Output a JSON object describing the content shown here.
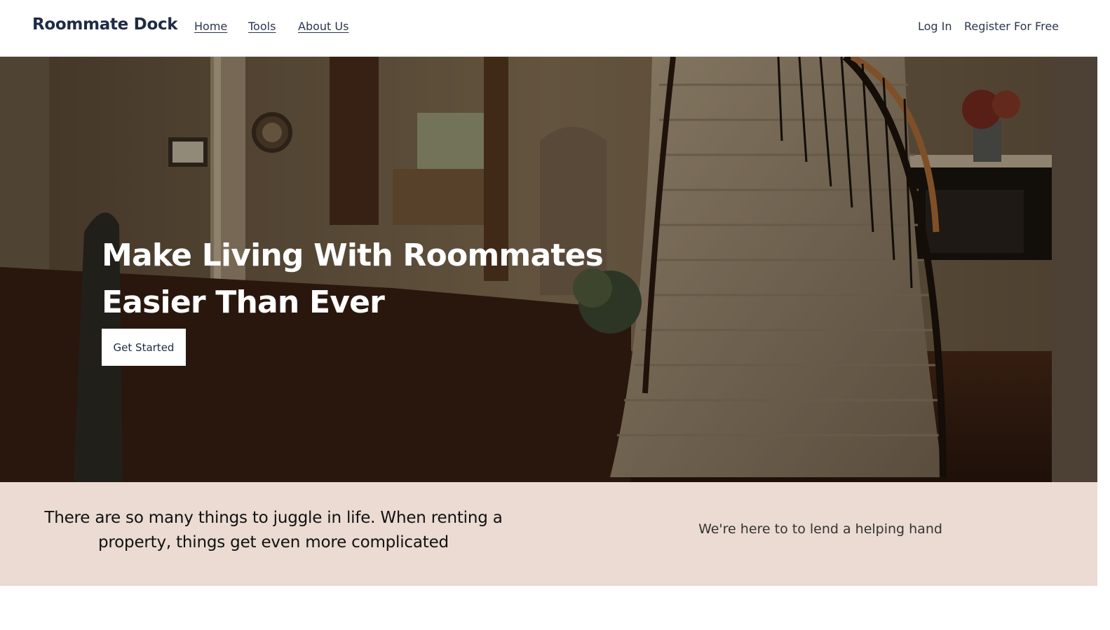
{
  "header": {
    "brand": "Roommate Dock",
    "nav": [
      {
        "label": "Home"
      },
      {
        "label": "Tools"
      },
      {
        "label": "About Us"
      }
    ],
    "login_label": "Log In",
    "register_label": "Register For Free"
  },
  "hero": {
    "title": "Make Living With Roommates Easier Than Ever",
    "cta_label": "Get Started"
  },
  "band": {
    "left_text": "There are so many things to juggle in life. When renting a property, things get even more complicated",
    "right_text": "We're here to to lend a helping hand"
  }
}
